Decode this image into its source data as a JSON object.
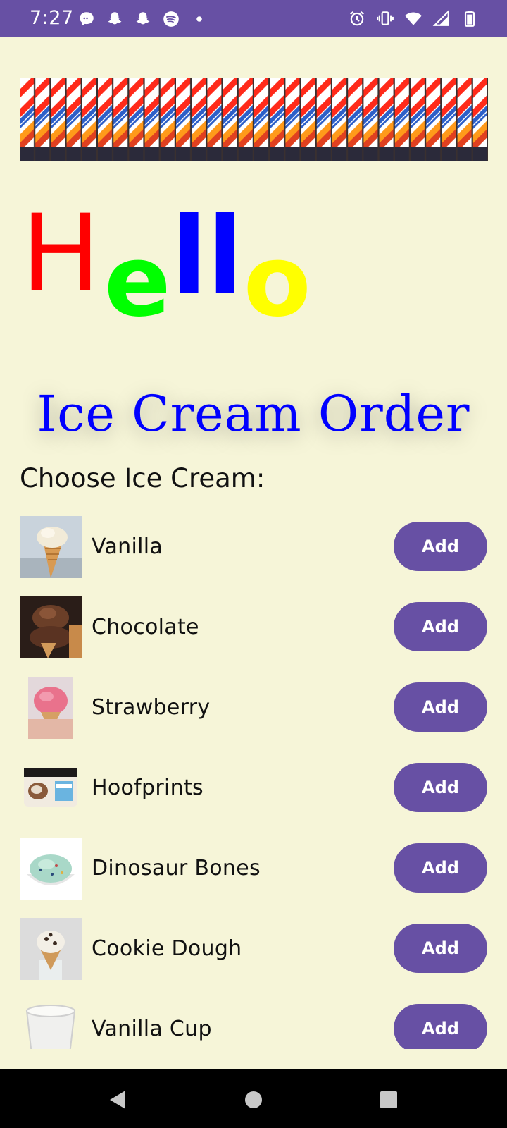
{
  "status_bar": {
    "time": "7:27",
    "left_icons": [
      "chat-bubble-icon",
      "snapchat-icon",
      "snapchat-icon",
      "spotify-icon",
      "dot-icon"
    ],
    "right_icons": [
      "alarm-icon",
      "vibrate-icon",
      "wifi-icon",
      "signal-icon",
      "battery-icon"
    ],
    "background": "#6750a4"
  },
  "banner": {
    "stripe_colors": [
      "#ff2a1a",
      "#ffffff",
      "#2d5fc8",
      "#ff9a1a",
      "#2b2a3a"
    ]
  },
  "hello": {
    "letters": [
      {
        "char": "H",
        "color": "#ff0000"
      },
      {
        "char": "e",
        "color": "#00ff00"
      },
      {
        "char": "l",
        "color": "#0000ff"
      },
      {
        "char": "l",
        "color": "#0000ff"
      },
      {
        "char": "o",
        "color": "#ffff00"
      }
    ]
  },
  "title": "Ice Cream Order",
  "choose_label": "Choose Ice Cream:",
  "items": [
    {
      "name": "Vanilla",
      "button": "Add",
      "image": "vanilla-cone-image"
    },
    {
      "name": "Chocolate",
      "button": "Add",
      "image": "chocolate-scoop-image"
    },
    {
      "name": "Strawberry",
      "button": "Add",
      "image": "strawberry-cone-image"
    },
    {
      "name": "Hoofprints",
      "button": "Add",
      "image": "hoofprints-tub-image"
    },
    {
      "name": "Dinosaur Bones",
      "button": "Add",
      "image": "dinosaur-bones-bowl-image"
    },
    {
      "name": "Cookie Dough",
      "button": "Add",
      "image": "cookie-dough-cone-image"
    },
    {
      "name": "Vanilla Cup",
      "button": "Add",
      "image": "vanilla-cup-image"
    }
  ],
  "colors": {
    "background": "#f6f5d8",
    "accent": "#6750a4",
    "title": "#0000ff"
  },
  "nav": {
    "buttons": [
      "back-icon",
      "home-icon",
      "recents-icon"
    ]
  }
}
